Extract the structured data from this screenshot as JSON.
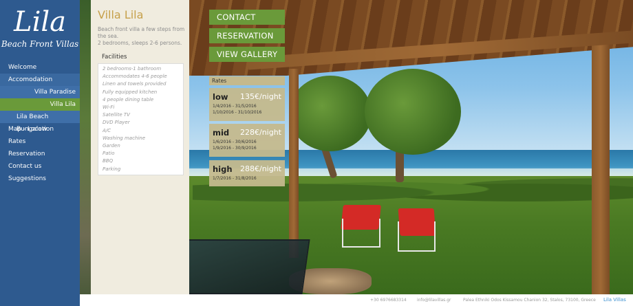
{
  "logo": {
    "main": "Lila",
    "sub": "Beach Front Villas"
  },
  "nav": [
    {
      "label": "Welcome"
    },
    {
      "label": "Accomodation"
    },
    {
      "label": "Villa Paradise"
    },
    {
      "label": "Villa Lila"
    },
    {
      "label": "Lila Beach Bungalow"
    },
    {
      "label": "Map - Location"
    },
    {
      "label": "Rates"
    },
    {
      "label": "Reservation"
    },
    {
      "label": "Contact us"
    },
    {
      "label": "Suggestions"
    }
  ],
  "villa": {
    "title": "Villa Lila",
    "desc_line1": "Beach front villa a few steps from the sea.",
    "desc_line2": "2 bedrooms, sleeps 2-6 persons.",
    "facilities_heading": "Facilities",
    "facilities": [
      "2 bedrooms-1 bathroom",
      "Accommodates 4-6 people",
      "Linen and towels provided",
      "Fully equipped kitchen",
      "4 people dining table",
      "Wi-Fi",
      "Satellite TV",
      "DVD Player",
      "A/C",
      "Washing machine",
      "Garden",
      "Patio",
      "BBQ",
      "Parking"
    ]
  },
  "actions": {
    "contact": "CONTACT",
    "reservation": "RESERVATION",
    "gallery": "VIEW GALLERY"
  },
  "rates": {
    "heading": "Rates",
    "items": [
      {
        "level": "low",
        "price": "135€/night",
        "dates": [
          "1/4/2016 - 31/5/2016",
          "1/10/2016 - 31/10/2016"
        ]
      },
      {
        "level": "mid",
        "price": "228€/night",
        "dates": [
          "1/6/2016 - 30/6/2016",
          "1/9/2016 - 30/9/2016"
        ]
      },
      {
        "level": "high",
        "price": "288€/night",
        "dates": [
          "1/7/2016 - 31/8/2016"
        ]
      }
    ]
  },
  "footer": {
    "phone": "+30 6976683314",
    "email": "info@lilavillas.gr",
    "address": "Palea Ethniki Odos Kissamou Chanion 32, Stalos, 73100, Greece",
    "brand": "Lila Villas"
  },
  "colors": {
    "sidebar": "#2e5a8f",
    "accent_green": "#6a9a3a",
    "gold": "#c6a04a",
    "rate_tan": "#c4b98d"
  }
}
